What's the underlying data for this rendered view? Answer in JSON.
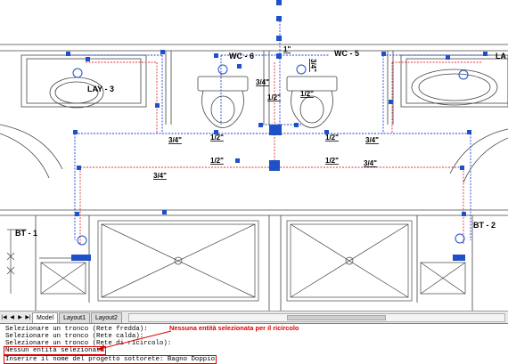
{
  "drawing": {
    "labels": {
      "lay3": "LAY - 3",
      "lay_right": "LA",
      "wc6": "WC - 6",
      "wc5": "WC - 5",
      "bt1": "BT - 1",
      "bt2": "BT - 2",
      "dim_1in": "1\"",
      "dim_34_a": "3/4\"",
      "dim_12_a": "1/2\"",
      "dim_12_b": "1/2\"",
      "dim_34_b": "3/4\"",
      "dim_12_c": "1/2\"",
      "dim_12_d": "1/2\"",
      "dim_34_c": "3/4\"",
      "dim_12_e": "1/2\"",
      "dim_12_f": "1/2\"",
      "dim_34_d": "3/4\"",
      "dim_34_e": "3/4\"",
      "dim_34_vert": "3/4\""
    }
  },
  "tabs": {
    "model": "Model",
    "layout1": "Layout1",
    "layout2": "Layout2"
  },
  "command": {
    "line1": "Selezionare un tronco (Rete fredda):",
    "line2": "Selezionare un tronco (Rete calda):",
    "line3": "Selezionare un tronco (Rete di ricircolo):",
    "line4": "Nessun entità selezionata",
    "line5": "Inserire il nome del progetto sottorete: Bagno Doppio",
    "annotation": "Nessuna entità selezionata per il ricircolo"
  },
  "colors": {
    "accent_red": "#e00000",
    "pipe_blue": "#1f3cd6",
    "pipe_red": "#e0303a",
    "grip_blue": "#1e50c8"
  },
  "icons": {
    "tab_nav": [
      "first-icon",
      "prev-icon",
      "next-icon",
      "last-icon"
    ]
  }
}
